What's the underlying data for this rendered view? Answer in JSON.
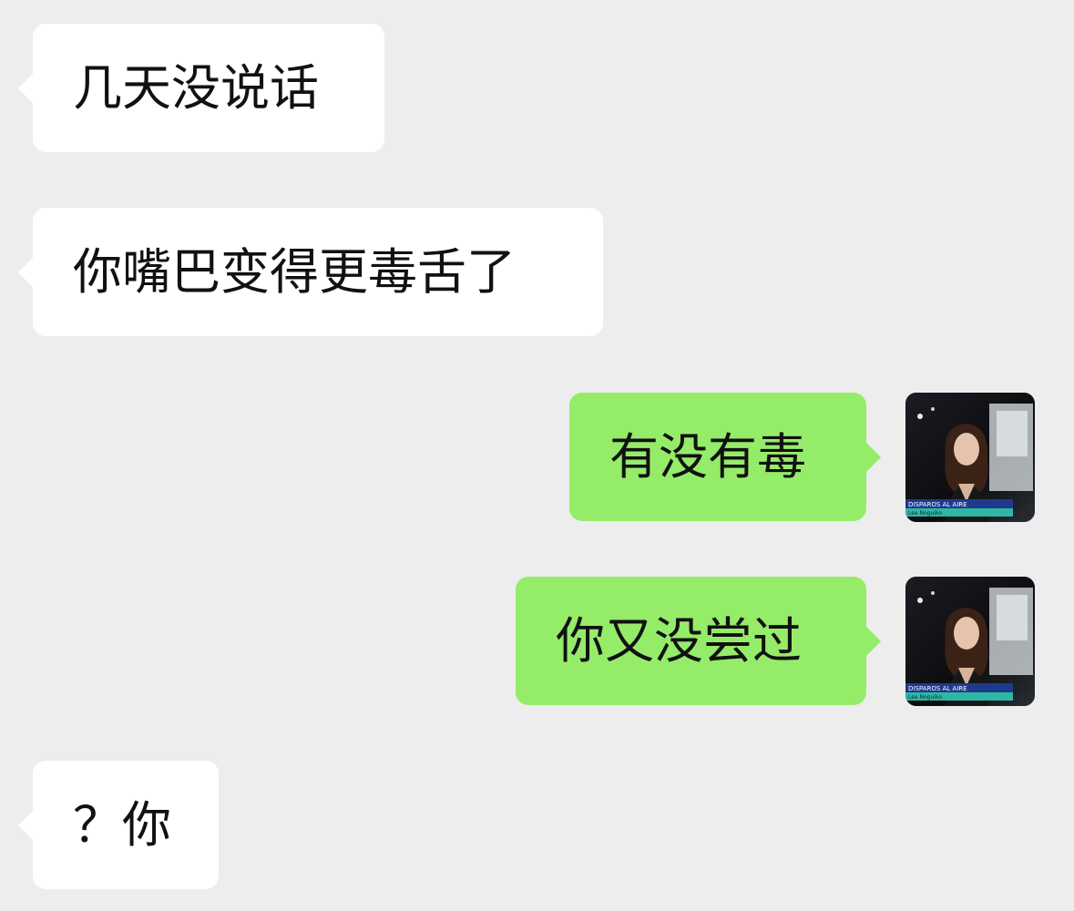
{
  "chat": {
    "messages": [
      {
        "side": "incoming",
        "text": "几天没说话"
      },
      {
        "side": "incoming",
        "text": "你嘴巴变得更毒舌了"
      },
      {
        "side": "outgoing",
        "text": "有没有毒"
      },
      {
        "side": "outgoing",
        "text": "你又没尝过"
      },
      {
        "side": "incoming",
        "text": "？你"
      }
    ],
    "avatar": {
      "caption_line1": "DISPAROS AL AIRE",
      "caption_line2": "Lea Noguiko",
      "icon": "user-avatar-photo"
    }
  },
  "colors": {
    "background": "#ededed",
    "incoming_bubble": "#ffffff",
    "outgoing_bubble": "#95ec69",
    "text": "#111111"
  }
}
